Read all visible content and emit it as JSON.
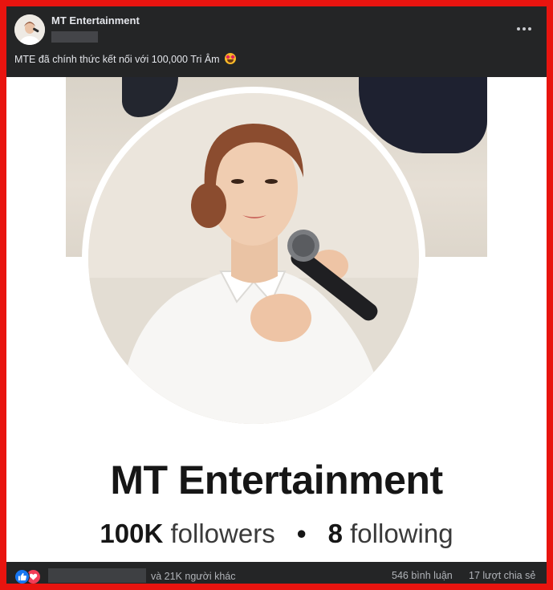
{
  "post": {
    "page_name": "MT Entertainment",
    "text": "MTE đã chính thức kết nối với 100,000 Tri Âm",
    "emoji": "star-struck-emoji"
  },
  "image": {
    "profile_name": "MT Entertainment",
    "followers_count": "100K",
    "followers_label": "followers",
    "separator": "•",
    "following_count": "8",
    "following_label": "following"
  },
  "footer": {
    "reaction_icons": [
      "like-icon",
      "love-icon"
    ],
    "others_text": "và 21K người khác",
    "comments": "546 bình luận",
    "shares": "17 lượt chia sẻ"
  },
  "colors": {
    "frame_border": "#e8140f",
    "dark_bar": "#242526",
    "like_blue": "#1877f2",
    "love_red": "#f33e58"
  }
}
